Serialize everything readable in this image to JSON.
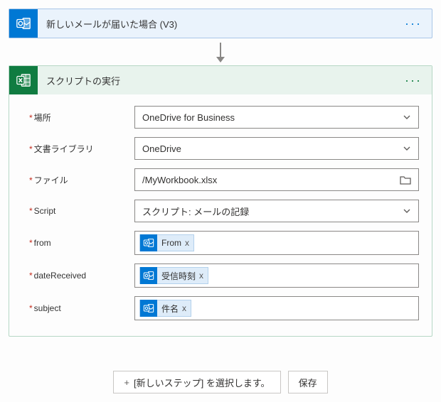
{
  "trigger": {
    "title": "新しいメールが届いた場合 (V3)"
  },
  "action": {
    "title": "スクリプトの実行",
    "fields": {
      "location": {
        "label": "場所",
        "value": "OneDrive for Business"
      },
      "library": {
        "label": "文書ライブラリ",
        "value": "OneDrive"
      },
      "file": {
        "label": "ファイル",
        "value": "/MyWorkbook.xlsx"
      },
      "script": {
        "label": "Script",
        "value": "スクリプト: メールの記録"
      },
      "from": {
        "label": "from",
        "token": "From"
      },
      "dateReceived": {
        "label": "dateReceived",
        "token": "受信時刻"
      },
      "subject": {
        "label": "subject",
        "token": "件名"
      }
    }
  },
  "footer": {
    "newStep": "[新しいステップ] を選択します。",
    "save": "保存"
  },
  "glyphs": {
    "x": "x",
    "plus": "+"
  }
}
